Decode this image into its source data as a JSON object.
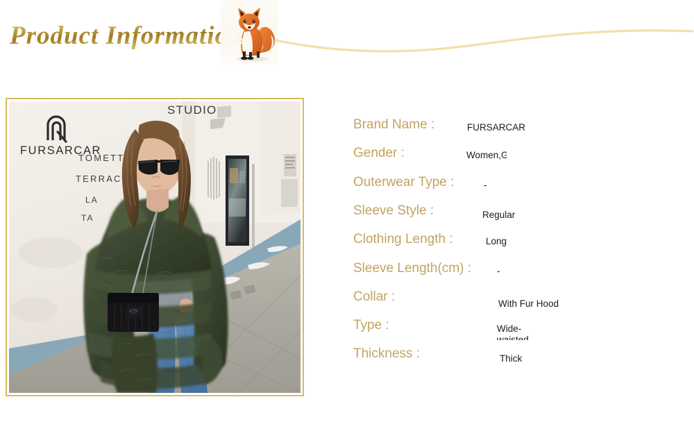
{
  "header": {
    "title": "Product Information",
    "title_color": "#B08A2E",
    "fox_icon": "fox-icon",
    "wave_icon": "wave-divider-icon",
    "wave_color": "#F2DFAB"
  },
  "photo": {
    "alt": "Woman wearing dark olive green real fox fur hooded coat on a city street",
    "watermark_brand": "FURSARCAR",
    "watermark_logo": "fursarcar-monogram-icon",
    "wall_text_1": "STUDIO",
    "wall_text_2": "TOMETTES",
    "wall_text_3": "TERRACOTTA",
    "wall_text_4": "LA",
    "wall_text_5": "TA",
    "frame_color": "#D9B95C"
  },
  "spec": {
    "label_color": "#C2A363",
    "rows": [
      {
        "label": "Brand Name :",
        "value": "FURSARCAR",
        "vx": 164,
        "vy": 8,
        "vw": 170,
        "vh": 18
      },
      {
        "label": "Gender :",
        "value": "Women,Girls,Ladies",
        "vx": 163,
        "vy": 7,
        "vw": 58,
        "vh": 24
      },
      {
        "label": "Outerwear Type :",
        "value": "-",
        "vx": 188,
        "vy": 8,
        "vw": 80,
        "vh": 18
      },
      {
        "label": "Sleeve Style :",
        "value": "Regular",
        "vx": 186,
        "vy": 10,
        "vw": 120,
        "vh": 18
      },
      {
        "label": "Clothing Length :",
        "value": "Long",
        "vx": 191,
        "vy": 7,
        "vw": 120,
        "vh": 18
      },
      {
        "label": "Sleeve Length(cm) :",
        "value": "-",
        "vx": 207,
        "vy": 8,
        "vw": 80,
        "vh": 18
      },
      {
        "label": "Collar :",
        "value": "With Fur Hood",
        "vx": 209,
        "vy": 14,
        "vw": 150,
        "vh": 18
      },
      {
        "label": "Type :",
        "value": "Wide-waisted",
        "vx": 207,
        "vy": 9,
        "vw": 48,
        "vh": 24
      },
      {
        "label": "Thickness :",
        "value": "Thick",
        "vx": 211,
        "vy": 11,
        "vw": 100,
        "vh": 18
      }
    ]
  }
}
